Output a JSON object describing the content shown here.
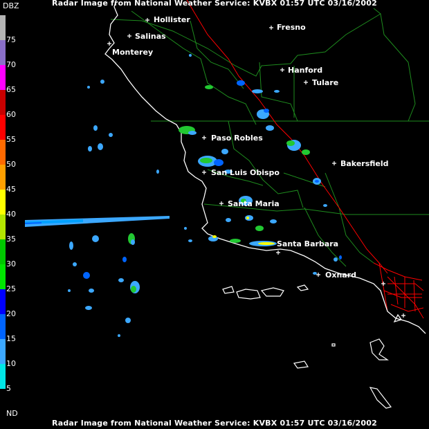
{
  "header": {
    "title": "Radar Image from National Weather Service: KVBX   01:57 UTC 03/16/2002"
  },
  "footer": {
    "title": "Radar Image from National Weather Service: KVBX   01:57 UTC 03/16/2002"
  },
  "legend": {
    "unit": "DBZ",
    "levels": [
      {
        "label": "75",
        "color": "#b4b4b4"
      },
      {
        "label": "70",
        "color": "#8a6fc8"
      },
      {
        "label": "65",
        "color": "#ff00ff"
      },
      {
        "label": "60",
        "color": "#c80000"
      },
      {
        "label": "55",
        "color": "#ff0000"
      },
      {
        "label": "50",
        "color": "#ff6a00"
      },
      {
        "label": "45",
        "color": "#ffa000"
      },
      {
        "label": "40",
        "color": "#ffff00"
      },
      {
        "label": "35",
        "color": "#b4e600"
      },
      {
        "label": "30",
        "color": "#00c800"
      },
      {
        "label": "25",
        "color": "#00e600"
      },
      {
        "label": "20",
        "color": "#0000ff"
      },
      {
        "label": "15",
        "color": "#0064ff"
      },
      {
        "label": "10",
        "color": "#3ca8ff"
      },
      {
        "label": "5",
        "color": "#00e6e6"
      },
      {
        "label": "ND",
        "color": "#000000"
      }
    ]
  },
  "cities": {
    "hollister": "Hollister",
    "salinas": "Salinas",
    "monterey": "Monterey",
    "fresno": "Fresno",
    "hanford": "Hanford",
    "tulare": "Tulare",
    "paso_robles": "Paso Robles",
    "bakersfield": "Bakersfield",
    "san_luis_obispo": "San Luis Obispo",
    "santa_maria": "Santa Maria",
    "santa_barbara": "Santa Barbara",
    "oxnard": "Oxnard"
  },
  "colors": {
    "coastline": "#ffffff",
    "county_lines": "#1e8c1e",
    "highway": "#ff0000",
    "background": "#000000"
  }
}
